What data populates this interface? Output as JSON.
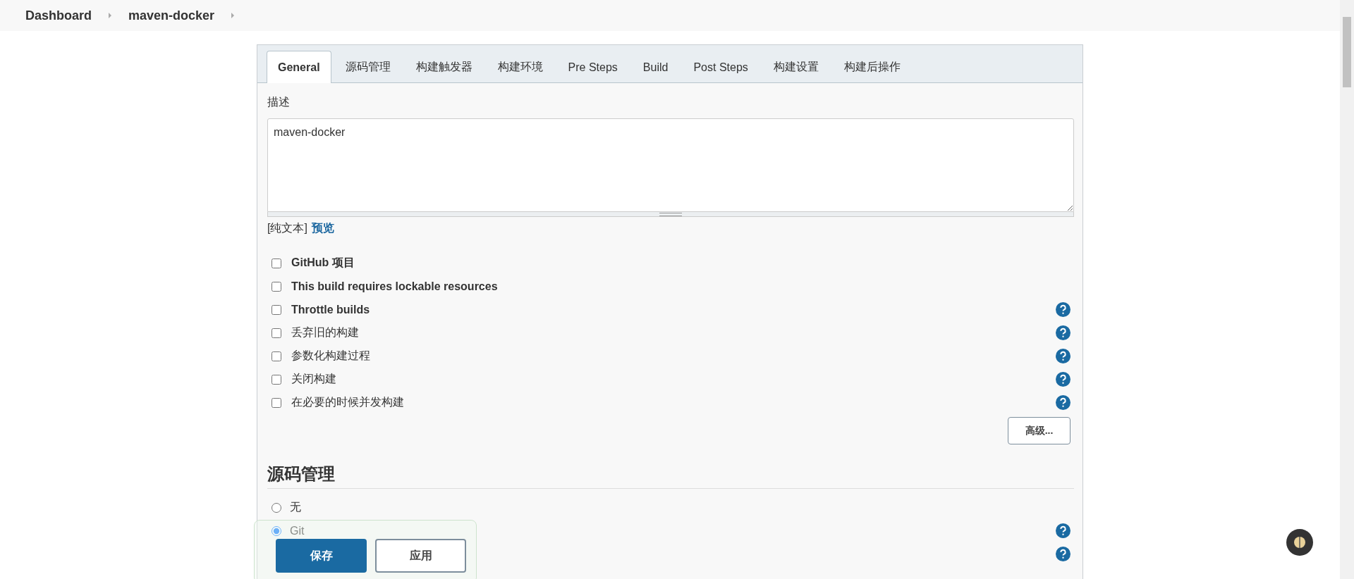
{
  "breadcrumb": [
    {
      "label": "Dashboard"
    },
    {
      "label": "maven-docker"
    }
  ],
  "tabs": [
    {
      "label": "General",
      "selected": true
    },
    {
      "label": "源码管理",
      "selected": false
    },
    {
      "label": "构建触发器",
      "selected": false
    },
    {
      "label": "构建环境",
      "selected": false
    },
    {
      "label": "Pre Steps",
      "selected": false
    },
    {
      "label": "Build",
      "selected": false
    },
    {
      "label": "Post Steps",
      "selected": false
    },
    {
      "label": "构建设置",
      "selected": false
    },
    {
      "label": "构建后操作",
      "selected": false
    }
  ],
  "description": {
    "label": "描述",
    "value": "maven-docker",
    "format": "[纯文本]",
    "preview_link": "预览"
  },
  "options": [
    {
      "label": "GitHub 项目",
      "checked": false,
      "bold": true,
      "help": false
    },
    {
      "label": "This build requires lockable resources",
      "checked": false,
      "bold": true,
      "help": false
    },
    {
      "label": "Throttle builds",
      "checked": false,
      "bold": true,
      "help": true
    },
    {
      "label": "丢弃旧的构建",
      "checked": false,
      "bold": false,
      "help": true
    },
    {
      "label": "参数化构建过程",
      "checked": false,
      "bold": false,
      "help": true
    },
    {
      "label": "关闭构建",
      "checked": false,
      "bold": false,
      "help": true
    },
    {
      "label": "在必要的时候并发构建",
      "checked": false,
      "bold": false,
      "help": true
    }
  ],
  "advanced_button": "高级...",
  "scm": {
    "title": "源码管理",
    "options": [
      {
        "label": "无",
        "selected": false,
        "help": false
      },
      {
        "label": "Git",
        "selected": true,
        "help": true
      }
    ],
    "extra_help": true
  },
  "bottom_bar": {
    "save": "保存",
    "apply": "应用"
  }
}
